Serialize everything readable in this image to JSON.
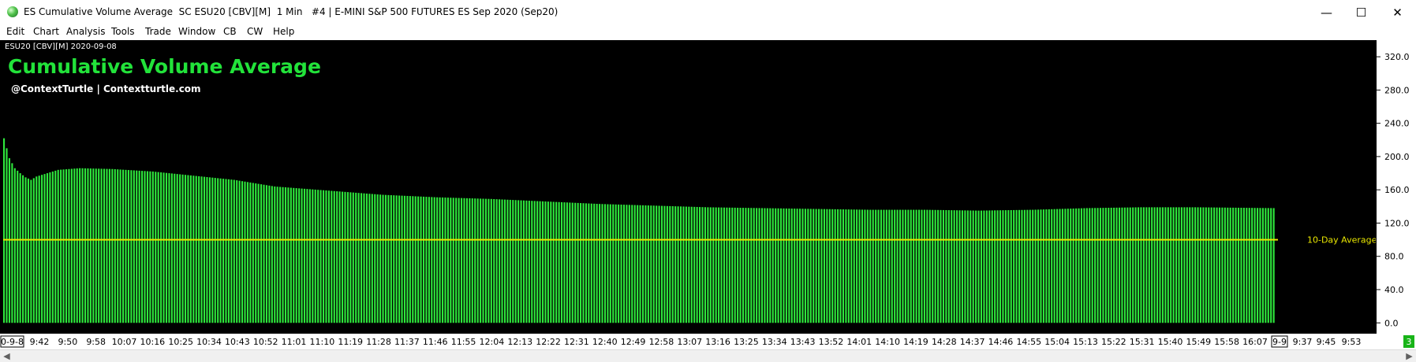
{
  "window": {
    "title": "ES Cumulative Volume Average  SC ESU20 [CBV][M]  1 Min   #4 | E-MINI S&P 500 FUTURES ES Sep 2020 (Sep20)",
    "minimize_glyph": "—",
    "maximize_glyph": "☐",
    "close_glyph": "✕"
  },
  "menu": [
    {
      "label": "Edit"
    },
    {
      "label": "Chart"
    },
    {
      "label": "Analysis"
    },
    {
      "label": "Tools"
    },
    {
      "label": "Trade"
    },
    {
      "label": "Window"
    },
    {
      "label": "CB"
    },
    {
      "label": "CW"
    },
    {
      "label": "Help"
    }
  ],
  "chart": {
    "symbol_header": "ESU20 [CBV][M]  2020-09-08",
    "study_title": "Cumulative Volume Average",
    "credit": "@ContextTurtle | Contextturtle.com",
    "reference_label": "10-Day Average",
    "colors": {
      "background": "#000000",
      "bars": "#2ee83c",
      "reference_line": "#e8e600",
      "title": "#22e33a",
      "credit": "#ffffff"
    }
  },
  "chart_data": {
    "type": "bar",
    "title": "Cumulative Volume Average",
    "xlabel": "",
    "ylabel": "",
    "ylim": [
      -13,
      340
    ],
    "y_ticks": [
      320,
      280,
      240,
      200,
      160,
      120,
      80,
      40,
      0
    ],
    "y_tick_labels": [
      "320.0",
      "280.0",
      "240.0",
      "200.0",
      "160.0",
      "120.0",
      "80.0",
      "40.0",
      "0.0"
    ],
    "x_tick_labels": [
      "9:42",
      "9:50",
      "9:58",
      "10:07",
      "10:16",
      "10:25",
      "10:34",
      "10:43",
      "10:52",
      "11:01",
      "11:10",
      "11:19",
      "11:28",
      "11:37",
      "11:46",
      "11:55",
      "12:04",
      "12:13",
      "12:22",
      "12:31",
      "12:40",
      "12:49",
      "12:58",
      "13:07",
      "13:16",
      "13:25",
      "13:34",
      "13:43",
      "13:52",
      "14:01",
      "14:10",
      "14:19",
      "14:28",
      "14:37",
      "14:46",
      "14:55",
      "15:04",
      "15:13",
      "15:22",
      "15:31",
      "15:40",
      "15:49",
      "15:58",
      "16:07",
      "9:37",
      "9:45",
      "9:53"
    ],
    "x_tick_start_label": "0-9-8",
    "x_tick_next_day_label": "9-9",
    "last_value_badge": "3",
    "reference_line": {
      "label": "10-Day Average",
      "value": 100
    },
    "bar_count": 470,
    "values_key_points": [
      [
        0,
        222
      ],
      [
        1,
        210
      ],
      [
        2,
        198
      ],
      [
        4,
        186
      ],
      [
        6,
        180
      ],
      [
        8,
        175
      ],
      [
        10,
        172
      ],
      [
        12,
        176
      ],
      [
        16,
        180
      ],
      [
        20,
        184
      ],
      [
        28,
        186
      ],
      [
        40,
        185
      ],
      [
        55,
        182
      ],
      [
        70,
        177
      ],
      [
        85,
        172
      ],
      [
        100,
        164
      ],
      [
        120,
        159
      ],
      [
        140,
        154
      ],
      [
        160,
        151
      ],
      [
        180,
        149
      ],
      [
        200,
        146
      ],
      [
        220,
        143
      ],
      [
        240,
        141
      ],
      [
        260,
        139
      ],
      [
        280,
        138
      ],
      [
        300,
        137
      ],
      [
        320,
        136
      ],
      [
        340,
        136
      ],
      [
        360,
        135
      ],
      [
        380,
        136
      ],
      [
        400,
        138
      ],
      [
        420,
        139
      ],
      [
        440,
        139
      ],
      [
        469,
        138
      ]
    ]
  },
  "status": {
    "badge_value": "3"
  }
}
